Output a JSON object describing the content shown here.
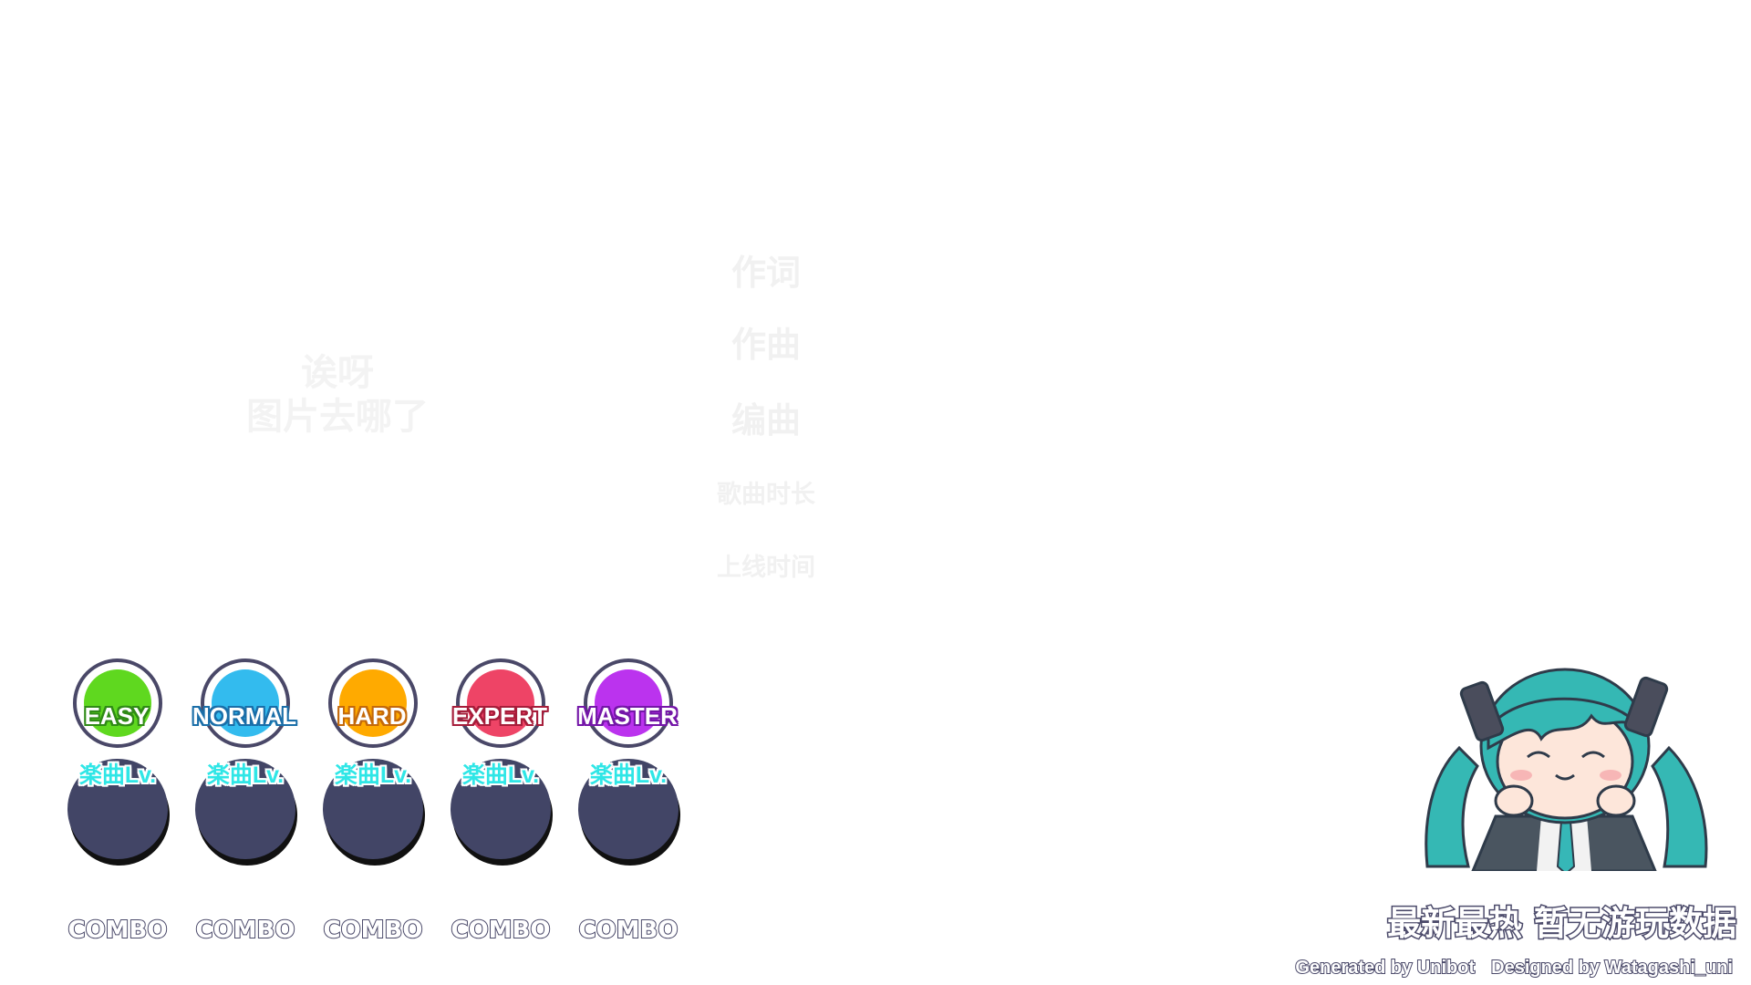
{
  "placeholder": {
    "line1": "诶呀",
    "line2": "图片去哪了"
  },
  "song_info": {
    "lyricist_label": "作词",
    "composer_label": "作曲",
    "arranger_label": "编曲",
    "duration_label": "歌曲时长",
    "release_label": "上线时间"
  },
  "difficulties": [
    {
      "name": "EASY",
      "color": "#5fd81f",
      "stroke": "#2f8a16",
      "level_label": "楽曲Lv.",
      "combo_label": "COMBO"
    },
    {
      "name": "NORMAL",
      "color": "#33bbee",
      "stroke": "#1a6ea8",
      "level_label": "楽曲Lv.",
      "combo_label": "COMBO"
    },
    {
      "name": "HARD",
      "color": "#ffaa00",
      "stroke": "#c4690a",
      "level_label": "楽曲Lv.",
      "combo_label": "COMBO"
    },
    {
      "name": "EXPERT",
      "color": "#ee4466",
      "stroke": "#a61d3a",
      "level_label": "楽曲Lv.",
      "combo_label": "COMBO"
    },
    {
      "name": "MASTER",
      "color": "#bb33ee",
      "stroke": "#7416a8",
      "level_label": "楽曲Lv.",
      "combo_label": "COMBO"
    }
  ],
  "mascot": {
    "icon": "hatsune-miku-chibi-icon"
  },
  "status": {
    "no_data_text": "最新最热 暂无游玩数据"
  },
  "credits": {
    "generated_by": "Generated by Unibot",
    "designed_by": "Designed by Watagashi_uni"
  }
}
